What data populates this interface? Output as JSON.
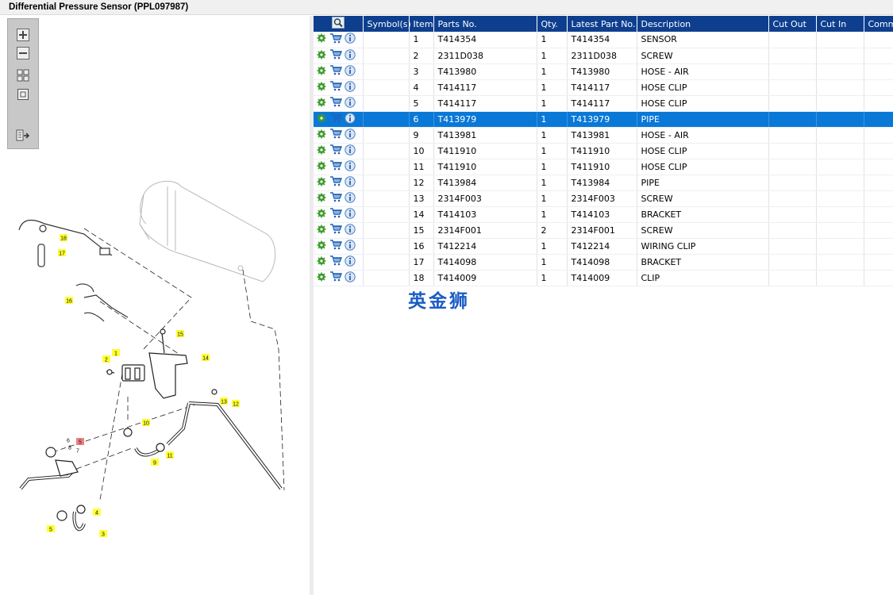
{
  "window": {
    "title": "Differential Pressure Sensor (PPL097987)"
  },
  "toolbar": {
    "buttons": [
      {
        "name": "zoom-in-button",
        "icon": "plus-icon"
      },
      {
        "name": "zoom-out-button",
        "icon": "minus-icon"
      },
      {
        "name": "fit-all-button",
        "icon": "grid-icon"
      },
      {
        "name": "actual-size-button",
        "icon": "square-icon"
      },
      {
        "name": "export-button",
        "icon": "export-icon"
      }
    ]
  },
  "table": {
    "columns": [
      "",
      "Symbol(s)",
      "Item",
      "Parts No.",
      "Qty.",
      "Latest Part No.",
      "Description",
      "Cut Out",
      "Cut In",
      "Comment"
    ],
    "selected_item": "6",
    "rows": [
      {
        "item": "1",
        "part": "T414354",
        "qty": "1",
        "latest": "T414354",
        "desc": "SENSOR"
      },
      {
        "item": "2",
        "part": "2311D038",
        "qty": "1",
        "latest": "2311D038",
        "desc": "SCREW"
      },
      {
        "item": "3",
        "part": "T413980",
        "qty": "1",
        "latest": "T413980",
        "desc": "HOSE - AIR"
      },
      {
        "item": "4",
        "part": "T414117",
        "qty": "1",
        "latest": "T414117",
        "desc": "HOSE CLIP"
      },
      {
        "item": "5",
        "part": "T414117",
        "qty": "1",
        "latest": "T414117",
        "desc": "HOSE CLIP"
      },
      {
        "item": "6",
        "part": "T413979",
        "qty": "1",
        "latest": "T413979",
        "desc": "PIPE"
      },
      {
        "item": "9",
        "part": "T413981",
        "qty": "1",
        "latest": "T413981",
        "desc": "HOSE - AIR"
      },
      {
        "item": "10",
        "part": "T411910",
        "qty": "1",
        "latest": "T411910",
        "desc": "HOSE CLIP"
      },
      {
        "item": "11",
        "part": "T411910",
        "qty": "1",
        "latest": "T411910",
        "desc": "HOSE CLIP"
      },
      {
        "item": "12",
        "part": "T413984",
        "qty": "1",
        "latest": "T413984",
        "desc": "PIPE"
      },
      {
        "item": "13",
        "part": "2314F003",
        "qty": "1",
        "latest": "2314F003",
        "desc": "SCREW"
      },
      {
        "item": "14",
        "part": "T414103",
        "qty": "1",
        "latest": "T414103",
        "desc": "BRACKET"
      },
      {
        "item": "15",
        "part": "2314F001",
        "qty": "2",
        "latest": "2314F001",
        "desc": "SCREW"
      },
      {
        "item": "16",
        "part": "T412214",
        "qty": "1",
        "latest": "T412214",
        "desc": "WIRING CLIP"
      },
      {
        "item": "17",
        "part": "T414098",
        "qty": "1",
        "latest": "T414098",
        "desc": "BRACKET"
      },
      {
        "item": "18",
        "part": "T414009",
        "qty": "1",
        "latest": "T414009",
        "desc": "CLIP"
      }
    ]
  },
  "diagram": {
    "callouts": [
      "18",
      "17",
      "16",
      "15",
      "14",
      "2",
      "1",
      "13",
      "12",
      "10",
      "11",
      "9",
      "8",
      "7",
      "6",
      "5",
      "4",
      "3",
      "5"
    ],
    "highlighted_callout": "5"
  },
  "watermark": {
    "text": "英金狮"
  },
  "colors": {
    "header_bg": "#0e3f8f",
    "selected_row": "#0a78d7",
    "callout_yellow": "#ffff33",
    "callout_highlight": "#f08080"
  }
}
